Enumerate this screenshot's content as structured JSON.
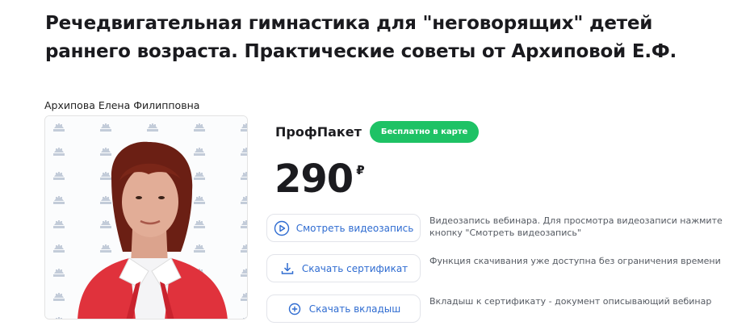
{
  "webinar": {
    "title": "Речедвигательная гимнастика для \"неговорящих\" детей раннего возраста. Практические советы от Архиповой Е.Ф.",
    "author": "Архипова Елена Филипповна",
    "photo_alt": "Архипова Елена Филипповна"
  },
  "package": {
    "name": "ПрофПакет",
    "badge": "Бесплатно в карте",
    "badge_color": "#1ec265",
    "price": "290",
    "currency": "₽"
  },
  "actions": [
    {
      "label": "Смотреть видеозапись",
      "icon": "play-icon",
      "description": "Видеозапись вебинара. Для просмотра видеозаписи нажмите кнопку \"Смотреть видеозапись\""
    },
    {
      "label": "Скачать сертификат",
      "icon": "download-icon",
      "description": "Функция скачивания уже доступна без ограничения времени"
    },
    {
      "label": "Скачать вкладыш",
      "icon": "plus-circle-icon",
      "description": "Вкладыш к сертификату - документ описывающий вебинар"
    }
  ],
  "colors": {
    "link": "#2f6cd1",
    "text": "#1b1b1f",
    "muted": "#555a62"
  }
}
